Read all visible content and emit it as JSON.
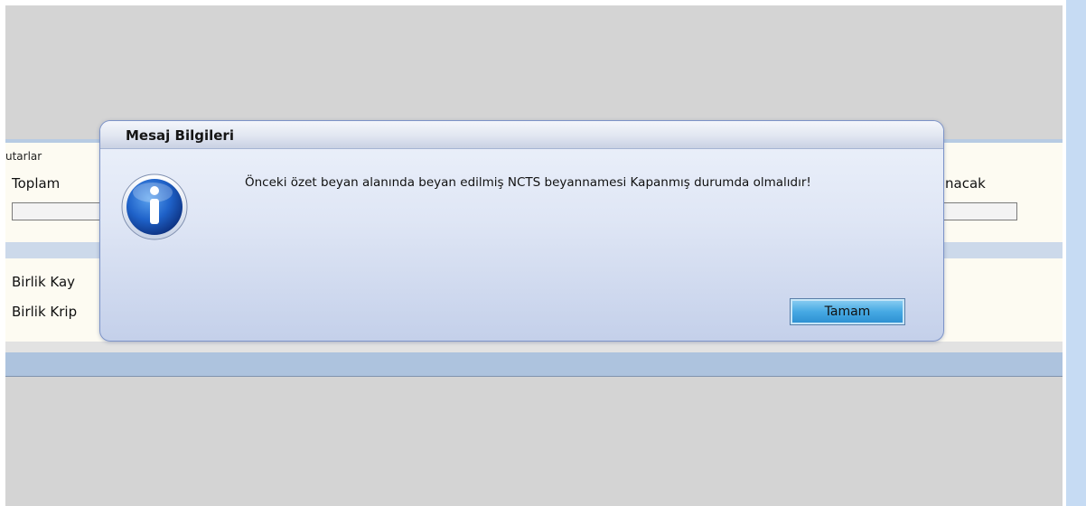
{
  "background": {
    "group_label": "utarlar",
    "total_label": "Toplam",
    "right_label": "nacak",
    "birlik_label_1": "Birlik Kay",
    "birlik_label_2": "Birlik Krip"
  },
  "dialog": {
    "title": "Mesaj Bilgileri",
    "message": "Önceki özet beyan alanında beyan edilmiş NCTS beyannamesi Kapanmış durumda olmalıdır!",
    "ok_label": "Tamam",
    "icon": "info-icon"
  },
  "colors": {
    "app_background": "#d4d4d4",
    "panel_background": "#fdfbf2",
    "accent_blue": "#46a9e3"
  }
}
